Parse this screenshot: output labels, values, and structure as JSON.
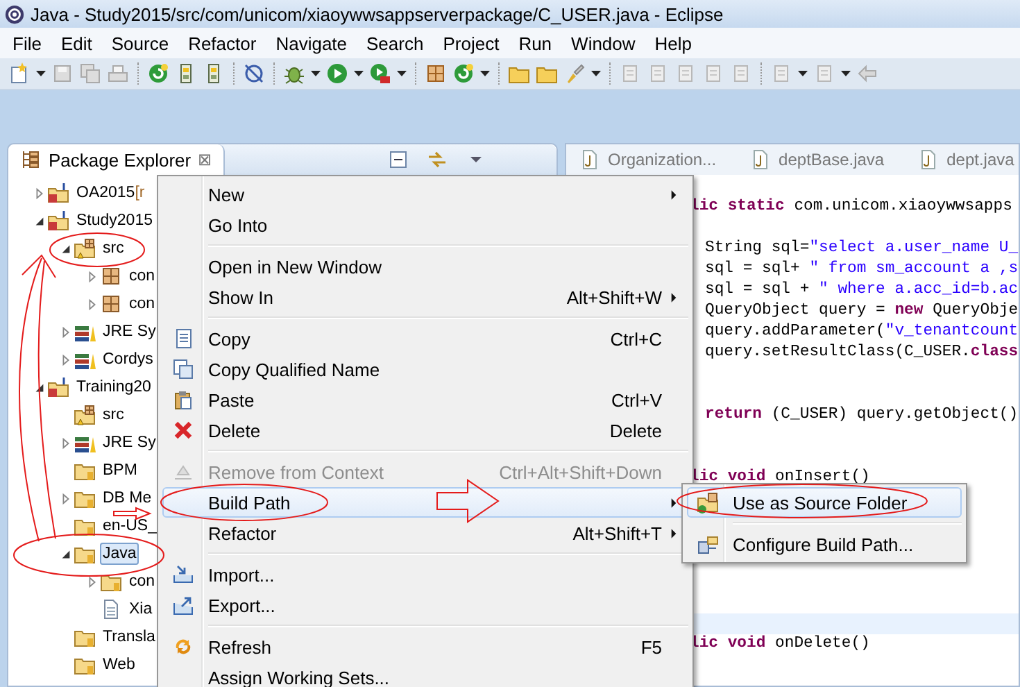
{
  "window": {
    "title": "Java - Study2015/src/com/unicom/xiaoywwsappserverpackage/C_USER.java - Eclipse"
  },
  "menu_bar": [
    "File",
    "Edit",
    "Source",
    "Refactor",
    "Navigate",
    "Search",
    "Project",
    "Run",
    "Window",
    "Help"
  ],
  "package_explorer": {
    "title": "Package Explorer",
    "close": "⊠",
    "tree": [
      {
        "label": "OA2015",
        "decoration": "[r",
        "kind": "project",
        "expanded": false,
        "selected": false
      },
      {
        "label": "Study2015",
        "kind": "project",
        "expanded": true,
        "selected": false,
        "children": [
          {
            "label": "src",
            "kind": "package_root",
            "expanded": true,
            "selected": false,
            "children": [
              {
                "label": "con",
                "kind": "package",
                "expanded": false,
                "selected": false
              },
              {
                "label": "con",
                "kind": "package",
                "expanded": false,
                "selected": false
              }
            ]
          },
          {
            "label": "JRE Sy",
            "kind": "library",
            "expanded": false,
            "selected": false
          },
          {
            "label": "Cordys",
            "kind": "library",
            "expanded": false,
            "selected": false
          }
        ]
      },
      {
        "label": "Training20",
        "kind": "project",
        "expanded": true,
        "selected": false,
        "children": [
          {
            "label": "src",
            "kind": "package_root",
            "selected": false
          },
          {
            "label": "JRE Sy",
            "kind": "library",
            "expanded": false,
            "selected": false
          },
          {
            "label": "BPM",
            "kind": "folder",
            "selected": false
          },
          {
            "label": "DB Me",
            "kind": "folder",
            "expanded": false,
            "selected": false
          },
          {
            "label": "en-US_",
            "kind": "folder",
            "selected": false
          },
          {
            "label": "Java",
            "kind": "folder",
            "expanded": true,
            "selected": true,
            "children": [
              {
                "label": "con",
                "kind": "folder",
                "expanded": false,
                "selected": false
              },
              {
                "label": "Xia",
                "kind": "file",
                "selected": false
              }
            ]
          },
          {
            "label": "Transla",
            "kind": "folder",
            "selected": false
          },
          {
            "label": "Web",
            "kind": "folder",
            "selected": false
          }
        ]
      }
    ]
  },
  "editor": {
    "tabs": [
      {
        "label": "Organization...",
        "selected": false
      },
      {
        "label": "deptBase.java",
        "selected": false
      },
      {
        "label": "dept.java",
        "selected": false
      }
    ],
    "lines": [
      {
        "kind": "decl",
        "tokens": [
          {
            "kind": "keyword",
            "text": "lic static"
          },
          {
            "kind": "plain",
            "text": " com.unicom.xiaoywwsapps"
          }
        ]
      },
      {
        "kind": "blank"
      },
      {
        "kind": "body",
        "tokens": [
          {
            "kind": "plain",
            "text": "String sql="
          },
          {
            "kind": "string",
            "text": "\"select a.user_name U_"
          }
        ]
      },
      {
        "kind": "body",
        "tokens": [
          {
            "kind": "plain",
            "text": "sql = sql+ "
          },
          {
            "kind": "string",
            "text": "\" from sm_account a ,s"
          }
        ]
      },
      {
        "kind": "body",
        "tokens": [
          {
            "kind": "plain",
            "text": "sql = sql + "
          },
          {
            "kind": "string",
            "text": "\" where a.acc_id=b.ac"
          }
        ]
      },
      {
        "kind": "body",
        "tokens": [
          {
            "kind": "plain",
            "text": "QueryObject query = "
          },
          {
            "kind": "keyword",
            "text": "new"
          },
          {
            "kind": "plain",
            "text": " QueryObje"
          }
        ]
      },
      {
        "kind": "body",
        "tokens": [
          {
            "kind": "plain",
            "text": "query.addParameter("
          },
          {
            "kind": "string",
            "text": "\"v_tenantcount"
          }
        ]
      },
      {
        "kind": "body",
        "tokens": [
          {
            "kind": "plain",
            "text": "query.setResultClass(C_USER."
          },
          {
            "kind": "keyword",
            "text": "class"
          }
        ]
      },
      {
        "kind": "blank"
      },
      {
        "kind": "blank"
      },
      {
        "kind": "body",
        "tokens": [
          {
            "kind": "keyword",
            "text": "return"
          },
          {
            "kind": "plain",
            "text": " (C_USER) query.getObject()"
          }
        ]
      },
      {
        "kind": "blank"
      },
      {
        "kind": "blank"
      },
      {
        "kind": "decl",
        "tokens": [
          {
            "kind": "keyword",
            "text": "lic void"
          },
          {
            "kind": "plain",
            "text": " onInsert()"
          }
        ]
      },
      {
        "kind": "blank"
      },
      {
        "kind": "blank"
      },
      {
        "kind": "blank"
      },
      {
        "kind": "blank"
      },
      {
        "kind": "blank"
      },
      {
        "kind": "blank"
      },
      {
        "kind": "current"
      },
      {
        "kind": "decl",
        "tokens": [
          {
            "kind": "keyword",
            "text": "lic void"
          },
          {
            "kind": "plain",
            "text": " onDelete()"
          }
        ]
      }
    ]
  },
  "context_menu": {
    "groups": [
      [
        {
          "label": "New",
          "submenu": true,
          "disabled": false,
          "selected": false
        },
        {
          "label": "Go Into",
          "disabled": false,
          "selected": false
        }
      ],
      [
        {
          "label": "Open in New Window",
          "disabled": false,
          "selected": false
        },
        {
          "label": "Show In",
          "shortcut": "Alt+Shift+W",
          "submenu": true,
          "disabled": false,
          "selected": false
        }
      ],
      [
        {
          "label": "Copy",
          "shortcut": "Ctrl+C",
          "disabled": false,
          "selected": false
        },
        {
          "label": "Copy Qualified Name",
          "disabled": false,
          "selected": false
        },
        {
          "label": "Paste",
          "shortcut": "Ctrl+V",
          "disabled": false,
          "selected": false
        },
        {
          "label": "Delete",
          "shortcut": "Delete",
          "disabled": false,
          "selected": false
        }
      ],
      [
        {
          "label": "Remove from Context",
          "shortcut": "Ctrl+Alt+Shift+Down",
          "disabled": true,
          "selected": false
        },
        {
          "label": "Build Path",
          "submenu": true,
          "disabled": false,
          "selected": true
        },
        {
          "label": "Refactor",
          "shortcut": "Alt+Shift+T",
          "submenu": true,
          "disabled": false,
          "selected": false
        }
      ],
      [
        {
          "label": "Import...",
          "disabled": false,
          "selected": false
        },
        {
          "label": "Export...",
          "disabled": false,
          "selected": false
        }
      ],
      [
        {
          "label": "Refresh",
          "shortcut": "F5",
          "disabled": false,
          "selected": false
        },
        {
          "label": "Assign Working Sets...",
          "disabled": false,
          "selected": false
        }
      ]
    ]
  },
  "submenu": {
    "groups": [
      [
        {
          "label": "Use as Source Folder",
          "selected": true
        }
      ],
      [
        {
          "label": "Configure Build Path...",
          "selected": false
        }
      ]
    ]
  }
}
